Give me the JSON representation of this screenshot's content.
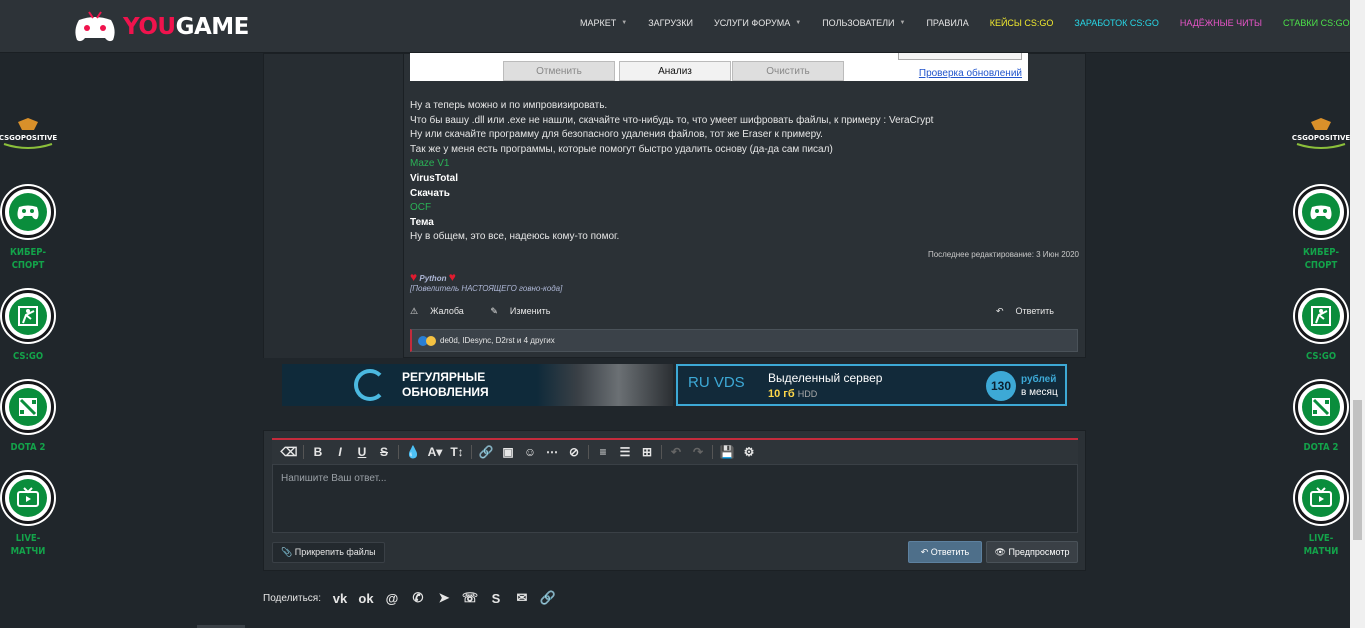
{
  "header": {
    "logo_you": "YOU",
    "logo_game": "GAME",
    "nav": [
      {
        "label": "МАРКЕТ",
        "caret": true,
        "color": "#e6e6e6"
      },
      {
        "label": "ЗАГРУЗКИ",
        "caret": false,
        "color": "#e6e6e6"
      },
      {
        "label": "УСЛУГИ ФОРУМА",
        "caret": true,
        "color": "#e6e6e6"
      },
      {
        "label": "ПОЛЬЗОВАТЕЛИ",
        "caret": true,
        "color": "#e6e6e6"
      },
      {
        "label": "ПРАВИЛА",
        "caret": false,
        "color": "#e6e6e6"
      },
      {
        "label": "КЕЙСЫ CS:GO",
        "caret": false,
        "color": "#f2ea2e"
      },
      {
        "label": "ЗАРАБОТОК CS:GO",
        "caret": false,
        "color": "#27d8e8"
      },
      {
        "label": "НАДЁЖНЫЕ ЧИТЫ",
        "caret": false,
        "color": "#e955c9"
      },
      {
        "label": "СТАВКИ CS:GO",
        "caret": false,
        "color": "#4ce24a"
      }
    ]
  },
  "sidebar": {
    "logo_text": "CSGOPOSITIVE",
    "items": [
      {
        "label": "КИБЕР-\nСПОРТ",
        "icon": "gamepad-icon"
      },
      {
        "label": "CS:GO",
        "icon": "soldier-icon"
      },
      {
        "label": "DOTA 2",
        "icon": "dota-icon"
      },
      {
        "label": "LIVE-\nМАТЧИ",
        "icon": "tv-icon"
      }
    ]
  },
  "screenshot_window": {
    "cancel": "Отменить",
    "analyze": "Анализ",
    "clear": "Очистить",
    "check_updates": "Проверка обновлений"
  },
  "post": {
    "lines": [
      {
        "text": "Ну а теперь можно и по импровизировать.",
        "style": "normal"
      },
      {
        "text": "Что бы вашу .dll или .exe не нашли, скачайте что-нибудь то, что умеет шифровать файлы, к примеру : VeraCrypt",
        "style": "normal"
      },
      {
        "text": "Ну или скачайте программу для безопасного удаления файлов, тот же Eraser к примеру.",
        "style": "normal"
      },
      {
        "text": "Так же у меня есть программы, которые помогут быстро удалить основу (да-да сам писал)",
        "style": "normal"
      },
      {
        "text": "Maze V1",
        "style": "green"
      },
      {
        "text": "VirusTotal",
        "style": "bold"
      },
      {
        "text": "Скачать",
        "style": "bold"
      },
      {
        "text": "OCF",
        "style": "green"
      },
      {
        "text": "Тема",
        "style": "bold"
      },
      {
        "text": "Ну в общем, это все, надеюсь кому-то помог.",
        "style": "normal"
      }
    ],
    "edited": "Последнее редактирование: 3 Июн 2020",
    "signature_name": "Python",
    "signature_line": "[Повелитель НАСТОЯЩЕГО говно-кода]",
    "report": "Жалоба",
    "edit": "Изменить",
    "reply": "Ответить",
    "reactions_text": "de0d, IDesync, D2rst и 4 других"
  },
  "banners": {
    "left_line1": "РЕГУЛЯРНЫЕ",
    "left_line2": "ОБНОВЛЕНИЯ",
    "right_logo": "RU VDS",
    "right_title": "Выделенный сервер",
    "right_spec": "10 гб",
    "right_spec_unit": "HDD",
    "right_price": "130",
    "right_currency": "рублей",
    "right_period": "в месяц"
  },
  "editor": {
    "placeholder": "Напишите Ваш ответ...",
    "attach": "Прикрепить файлы",
    "reply_button": "Ответить",
    "preview_button": "Предпросмотр"
  },
  "share": {
    "label": "Поделиться:",
    "icons": [
      "vk-icon",
      "odnoklassniki-icon",
      "mail-icon",
      "whatsapp-icon",
      "telegram-icon",
      "viber-icon",
      "skype-icon",
      "email-icon",
      "link-icon"
    ]
  }
}
